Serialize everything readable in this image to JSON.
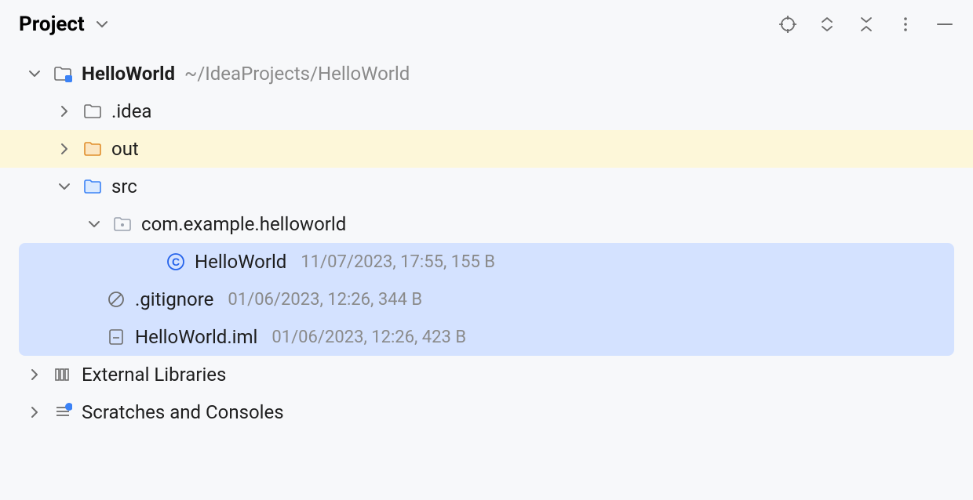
{
  "header": {
    "title": "Project"
  },
  "tree": {
    "project": {
      "name": "HelloWorld",
      "path": "~/IdeaProjects/HelloWorld"
    },
    "idea": {
      "name": ".idea"
    },
    "out": {
      "name": "out"
    },
    "src": {
      "name": "src"
    },
    "pkg": {
      "name": "com.example.helloworld"
    },
    "cls": {
      "name": "HelloWorld",
      "meta": "11/07/2023, 17:55, 155 B"
    },
    "gitignore": {
      "name": ".gitignore",
      "meta": "01/06/2023, 12:26, 344 B"
    },
    "iml": {
      "name": "HelloWorld.iml",
      "meta": "01/06/2023, 12:26, 423 B"
    },
    "ext": {
      "name": "External Libraries"
    },
    "scratch": {
      "name": "Scratches and Consoles"
    }
  }
}
